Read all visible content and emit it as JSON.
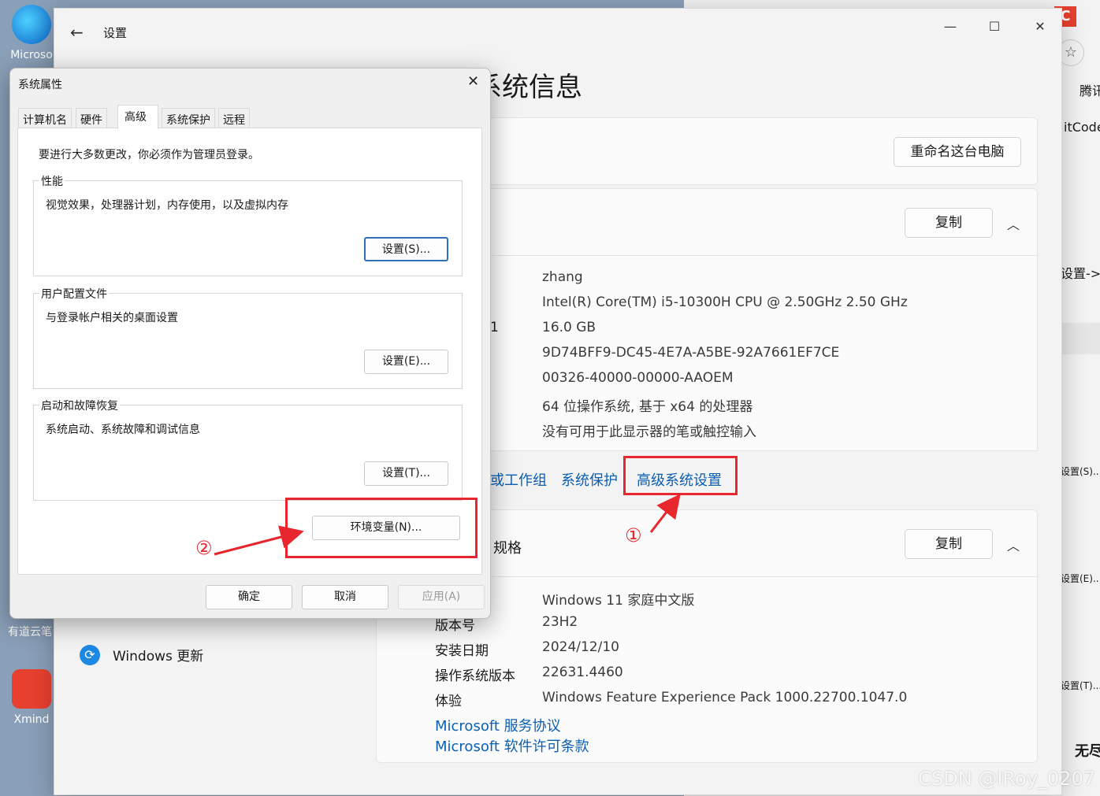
{
  "desktop": {
    "icons": [
      {
        "label": "Microso",
        "color": "#1b8de0"
      },
      {
        "label": "有道云笔",
        "color": "#c44"
      },
      {
        "label": "Xmind",
        "color": "#e8402f"
      }
    ]
  },
  "background_window": {
    "tab_badge_text": "C",
    "accent": "#e8402f",
    "items": [
      "腾讯",
      "itCode",
      "设置->",
      "设置(S)...",
      "设置(E)...",
      "设置(T)...",
      "无尽"
    ]
  },
  "settings": {
    "title": "设置",
    "page_heading": "系统信息",
    "rename_button": "重命名这台电脑",
    "device_section": {
      "copy_button": "复制",
      "rows": [
        {
          "label": "",
          "value": "zhang"
        },
        {
          "label": "",
          "value": "Intel(R) Core(TM) i5-10300H CPU @ 2.50GHz   2.50 GHz"
        },
        {
          "label": "1",
          "value": "16.0 GB"
        },
        {
          "label": "",
          "value": "9D74BFF9-DC45-4E7A-A5BE-92A7661EF7CE"
        },
        {
          "label": "",
          "value": "00326-40000-00000-AAOEM"
        },
        {
          "label": "",
          "value": "64 位操作系统, 基于 x64 的处理器"
        },
        {
          "label": "",
          "value": "没有可用于此显示器的笔或触控输入"
        }
      ],
      "links": [
        "或工作组",
        "系统保护",
        "高级系统设置"
      ]
    },
    "windows_section": {
      "title": "规格",
      "copy_button": "复制",
      "rows": [
        {
          "label": "",
          "value": "Windows 11 家庭中文版"
        },
        {
          "label": "版本号",
          "value": "23H2"
        },
        {
          "label": "安装日期",
          "value": "2024/12/10"
        },
        {
          "label": "操作系统版本",
          "value": "22631.4460"
        },
        {
          "label": "体验",
          "value": "Windows Feature Experience Pack 1000.22700.1047.0"
        }
      ],
      "links": [
        "Microsoft 服务协议",
        "Microsoft 软件许可条款"
      ]
    },
    "sidebar_item": "Windows 更新"
  },
  "dialog": {
    "title": "系统属性",
    "tabs": [
      "计算机名",
      "硬件",
      "高级",
      "系统保护",
      "远程"
    ],
    "admin_note": "要进行大多数更改，你必须作为管理员登录。",
    "groups": [
      {
        "title": "性能",
        "desc": "视觉效果，处理器计划，内存使用，以及虚拟内存",
        "button": "设置(S)..."
      },
      {
        "title": "用户配置文件",
        "desc": "与登录帐户相关的桌面设置",
        "button": "设置(E)..."
      },
      {
        "title": "启动和故障恢复",
        "desc": "系统启动、系统故障和调试信息",
        "button": "设置(T)..."
      }
    ],
    "env_button": "环境变量(N)...",
    "ok": "确定",
    "cancel": "取消",
    "apply": "应用(A)"
  },
  "annotations": {
    "step1": "①",
    "step2": "②",
    "color": "#e8262e"
  },
  "watermark": "CSDN @IRoy_0207"
}
